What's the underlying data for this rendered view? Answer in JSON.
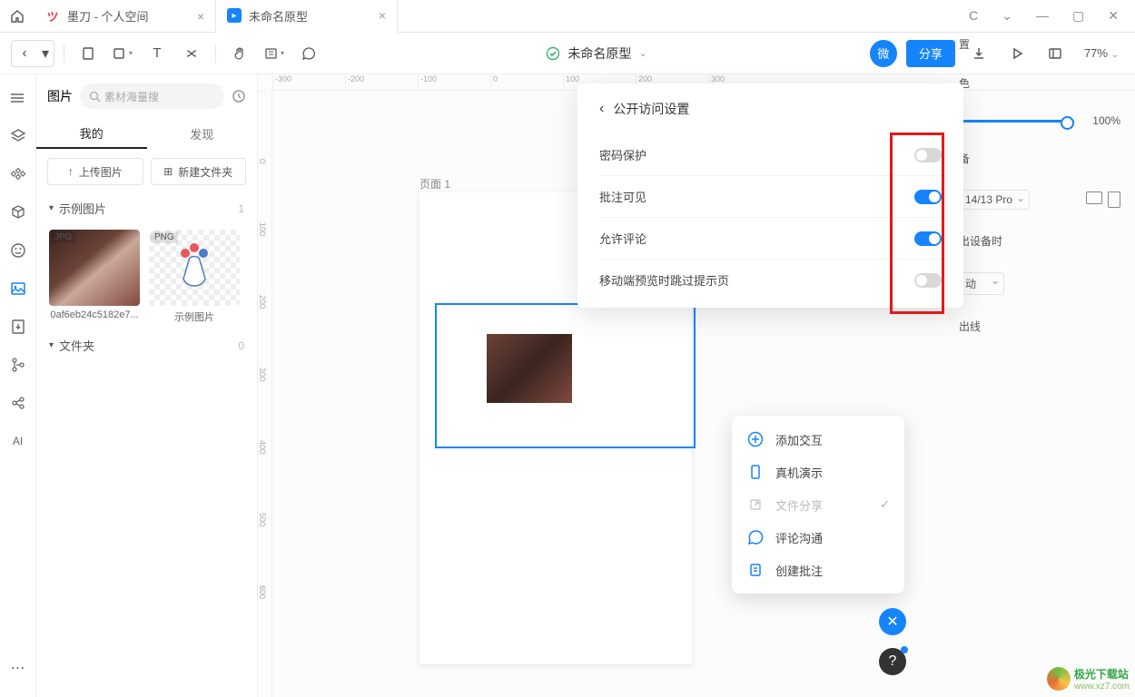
{
  "titlebar": {
    "tabs": [
      {
        "favicon": "modao",
        "label": "墨刀 - 个人空间"
      },
      {
        "favicon": "doc",
        "label": "未命名原型"
      }
    ]
  },
  "toolbar": {
    "doc_title": "未命名原型",
    "badge": "微",
    "share": "分享",
    "zoom": "77%"
  },
  "sidebar": {
    "title": "图片",
    "search_placeholder": "素材海量搜",
    "tabs": {
      "mine": "我的",
      "discover": "发现"
    },
    "actions": {
      "upload": "上传图片",
      "new_folder": "新建文件夹"
    },
    "example_section": {
      "label": "示例图片",
      "count": "1"
    },
    "thumbs": [
      {
        "badge": "JPG",
        "label": "0af6eb24c5182e7..."
      },
      {
        "badge": "PNG",
        "label": "示例图片"
      }
    ],
    "folder_section": {
      "label": "文件夹",
      "count": "0"
    }
  },
  "left_rail": {
    "ai": "AI"
  },
  "canvas": {
    "page_label": "页面 1",
    "h_ticks": [
      "-300",
      "-200",
      "-100",
      "0",
      "100",
      "200",
      "300"
    ],
    "v_ticks": [
      "0",
      "100",
      "200",
      "300",
      "400",
      "500",
      "600"
    ]
  },
  "right_panel": {
    "row1": "置",
    "row2": "色",
    "opacity_value": "100%",
    "row3": "备",
    "device": "14/13 Pro",
    "row4": "出设备时",
    "overflow": "动",
    "row5": "出线"
  },
  "float_menu": {
    "items": [
      {
        "icon": "plus-circle",
        "label": "添加交互",
        "color": "#1684fc"
      },
      {
        "icon": "phone",
        "label": "真机演示",
        "color": "#1684fc"
      },
      {
        "icon": "share-out",
        "label": "文件分享",
        "color": "#bbb",
        "disabled": true,
        "check": true
      },
      {
        "icon": "comment",
        "label": "评论沟通",
        "color": "#1684fc"
      },
      {
        "icon": "note",
        "label": "创建批注",
        "color": "#1684fc"
      }
    ]
  },
  "modal": {
    "title": "公开访问设置",
    "rows": [
      {
        "label": "密码保护",
        "on": false
      },
      {
        "label": "批注可见",
        "on": true
      },
      {
        "label": "允许评论",
        "on": true
      },
      {
        "label": "移动端预览时跳过提示页",
        "on": false
      }
    ]
  },
  "fabs": {
    "close": "✕",
    "help": "?"
  },
  "watermark": {
    "name": "极光下载站",
    "url": "www.xz7.com"
  }
}
